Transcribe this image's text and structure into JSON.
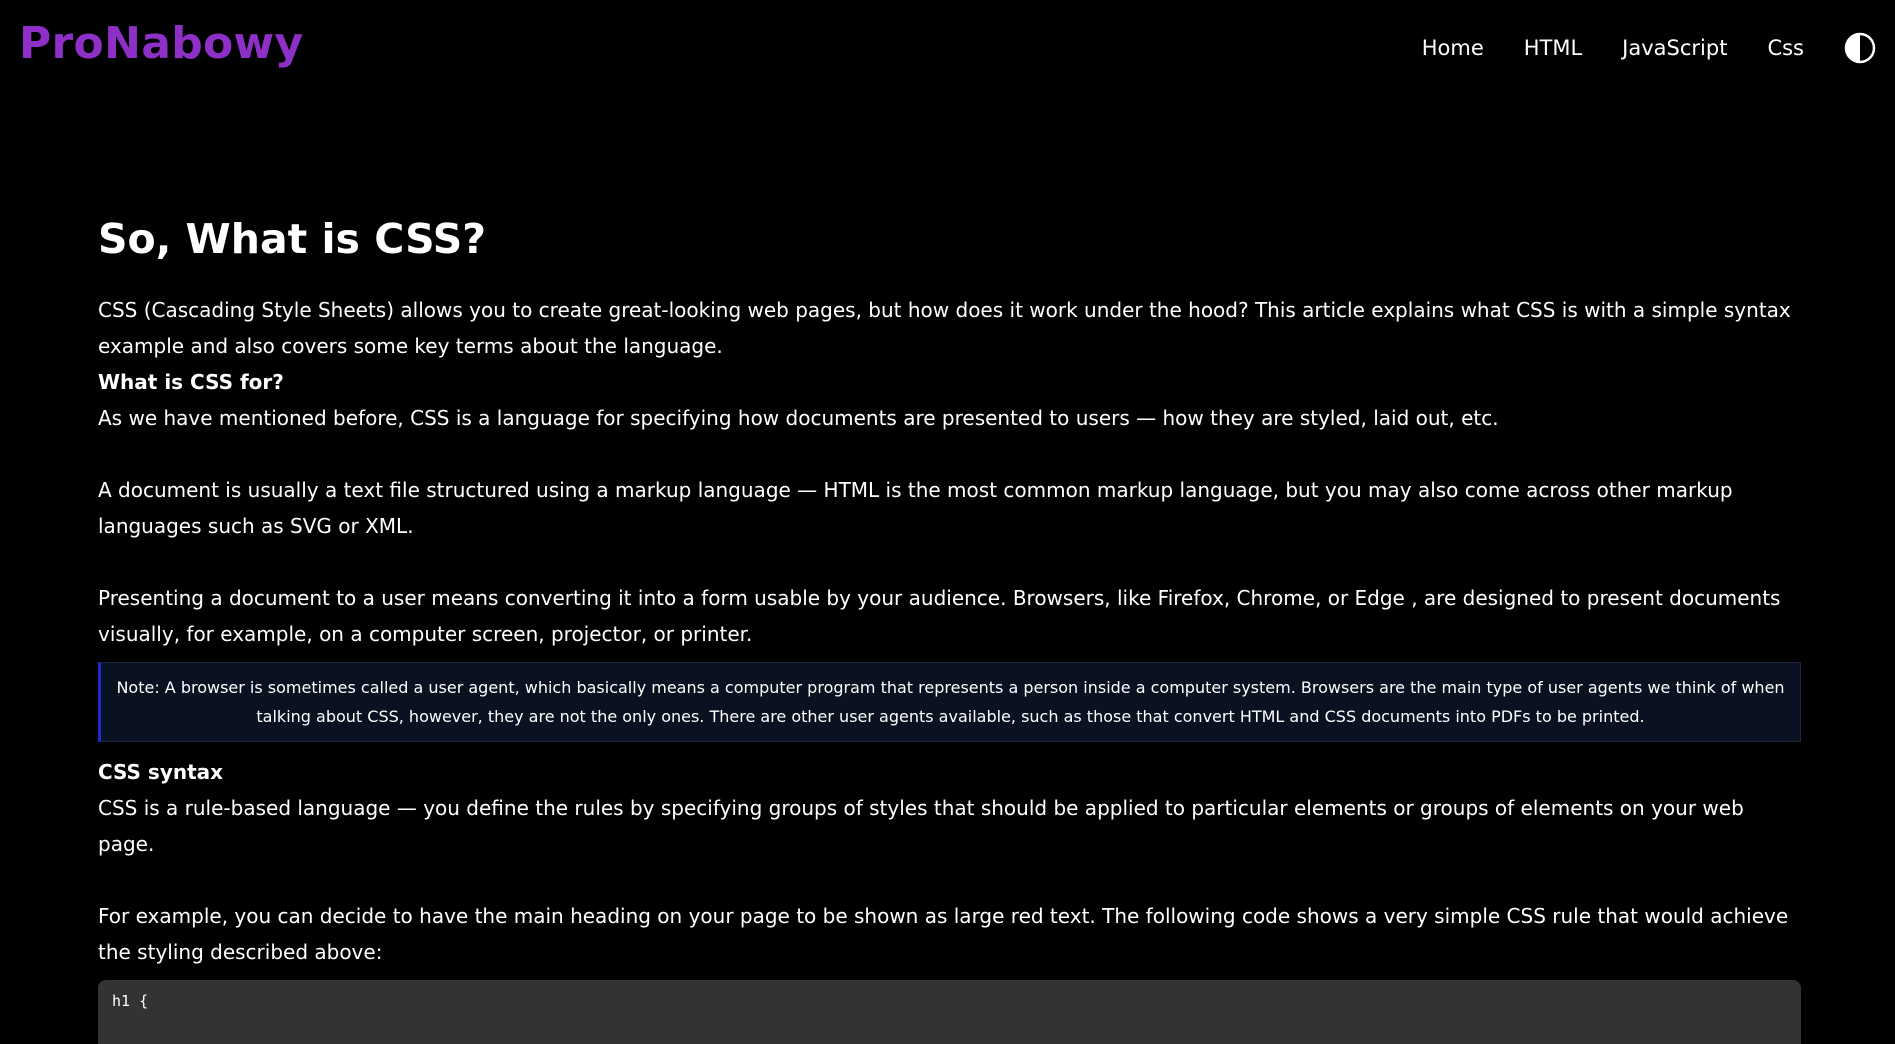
{
  "header": {
    "logo": "ProNabowy",
    "nav": [
      "Home",
      "HTML",
      "JavaScript",
      "Css"
    ],
    "theme_toggle_icon": "contrast-icon"
  },
  "article": {
    "title": "So, What is CSS?",
    "intro": "CSS (Cascading Style Sheets) allows you to create great-looking web pages, but how does it work under the hood? This article explains what CSS is with a simple syntax example and also covers some key terms about the language.",
    "section1_heading": "What is CSS for?",
    "section1_p1": "As we have mentioned before, CSS is a language for specifying how documents are presented to users — how they are styled, laid out, etc.",
    "section1_p2": "A document is usually a text file structured using a markup language — HTML is the most common markup language, but you may also come across other markup languages such as SVG or XML.",
    "section1_p3": "Presenting a document to a user means converting it into a form usable by your audience. Browsers, like Firefox, Chrome, or Edge , are designed to present documents visually, for example, on a computer screen, projector, or printer.",
    "note": "Note: A browser is sometimes called a user agent, which basically means a computer program that represents a person inside a computer system. Browsers are the main type of user agents we think of when talking about CSS, however, they are not the only ones. There are other user agents available, such as those that convert HTML and CSS documents into PDFs to be printed.",
    "section2_heading": "CSS syntax",
    "section2_p1": "CSS is a rule-based language — you define the rules by specifying groups of styles that should be applied to particular elements or groups of elements on your web page.",
    "section2_p2": "For example, you can decide to have the main heading on your page to be shown as large red text. The following code shows a very simple CSS rule that would achieve the styling described above:",
    "code_line1": "h1  {"
  }
}
